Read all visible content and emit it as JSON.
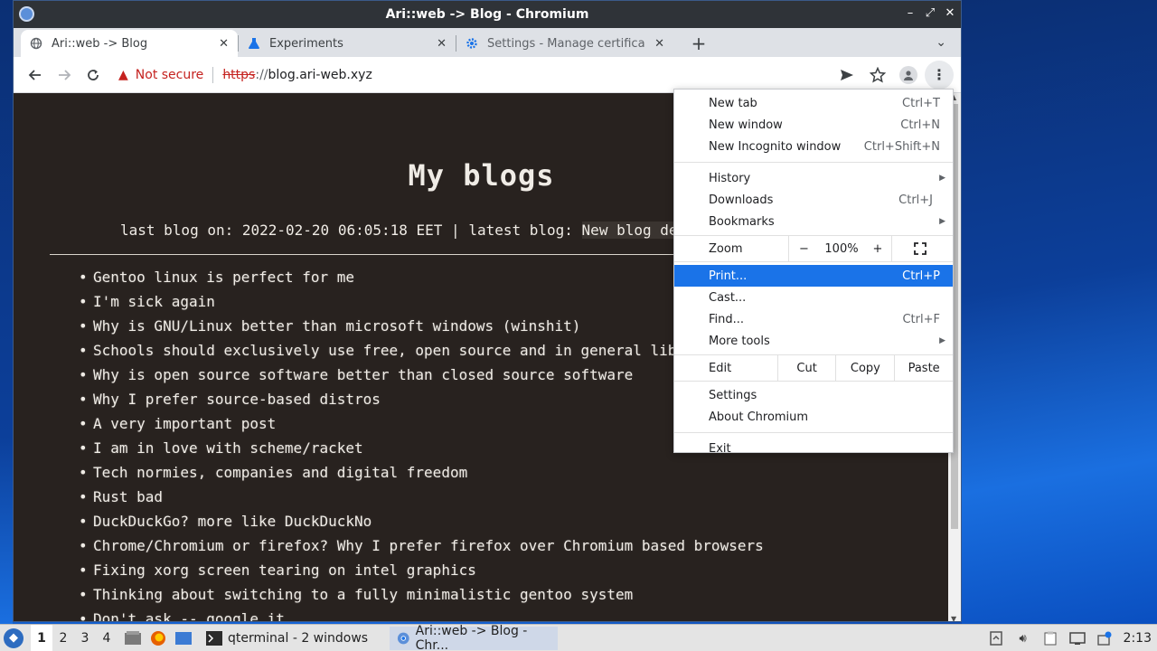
{
  "window": {
    "title": "Ari::web -> Blog - Chromium"
  },
  "tabs": [
    {
      "label": "Ari::web -> Blog",
      "icon": "globe-icon",
      "active": true
    },
    {
      "label": "Experiments",
      "icon": "flask-icon",
      "active": false
    },
    {
      "label": "Settings - Manage certifica",
      "icon": "gear-icon",
      "active": false
    }
  ],
  "toolbar": {
    "security_label": "Not secure",
    "url_scheme": "https",
    "url_sep": "://",
    "url_host": "blog.ari-web.xyz"
  },
  "page": {
    "title": "My blogs",
    "meta_prefix": "last blog on: 2022-02-20 06:05:18 EET | latest blog: ",
    "meta_link": "New blog de",
    "posts": [
      "Gentoo linux is perfect for me",
      "I'm sick again",
      "Why is GNU/Linux better than microsoft windows (winshit)",
      "Schools should exclusively use free, open source and in general lib",
      "Why is open source software better than closed source software",
      "Why I prefer source-based distros",
      "A very important post",
      "I am in love with scheme/racket",
      "Tech normies, companies and digital freedom",
      "Rust bad",
      "DuckDuckGo? more like DuckDuckNo",
      "Chrome/Chromium or firefox? Why I prefer firefox over Chromium based browsers",
      "Fixing xorg screen tearing on intel graphics",
      "Thinking about switching to a fully minimalistic gentoo system",
      "Don't ask -- google it"
    ]
  },
  "menu": {
    "new_tab": {
      "label": "New tab",
      "shortcut": "Ctrl+T"
    },
    "new_window": {
      "label": "New window",
      "shortcut": "Ctrl+N"
    },
    "new_incognito": {
      "label": "New Incognito window",
      "shortcut": "Ctrl+Shift+N"
    },
    "history": {
      "label": "History"
    },
    "downloads": {
      "label": "Downloads",
      "shortcut": "Ctrl+J"
    },
    "bookmarks": {
      "label": "Bookmarks"
    },
    "zoom": {
      "label": "Zoom",
      "minus": "−",
      "value": "100%",
      "plus": "+"
    },
    "print": {
      "label": "Print...",
      "shortcut": "Ctrl+P"
    },
    "cast": {
      "label": "Cast..."
    },
    "find": {
      "label": "Find...",
      "shortcut": "Ctrl+F"
    },
    "more_tools": {
      "label": "More tools"
    },
    "edit": {
      "label": "Edit",
      "cut": "Cut",
      "copy": "Copy",
      "paste": "Paste"
    },
    "settings": {
      "label": "Settings"
    },
    "about": {
      "label": "About Chromium"
    },
    "exit": {
      "label": "Exit"
    }
  },
  "taskbar": {
    "workspaces": [
      "1",
      "2",
      "3",
      "4"
    ],
    "tasks": [
      {
        "label": "qterminal - 2 windows",
        "icon": "terminal-icon"
      },
      {
        "label": "Ari::web -> Blog - Chr...",
        "icon": "chromium-icon"
      }
    ],
    "clock": "2:13"
  },
  "colors": {
    "accent": "#1a73e8",
    "page_bg": "#28221f",
    "warning": "#c5221f"
  }
}
